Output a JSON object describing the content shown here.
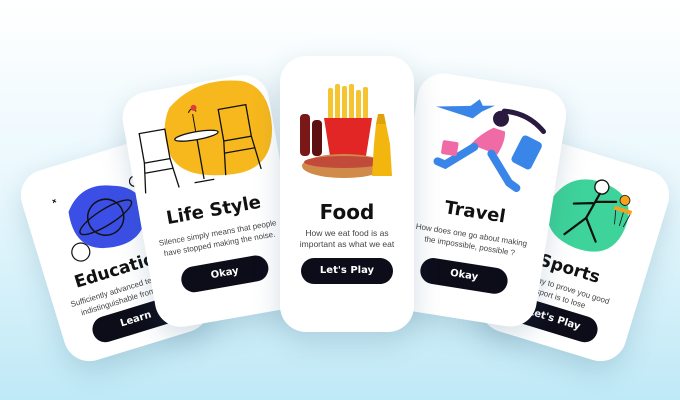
{
  "cards": [
    {
      "title": "Education",
      "text": "Sufficiently advanced technolo is indistinguishable from magic",
      "button": "Learn",
      "blob_color": "#3b4fe6"
    },
    {
      "title": "Life Style",
      "text": "Silence simply means that people have stopped making the noise.",
      "button": "Okay",
      "blob_color": "#f7b81d"
    },
    {
      "title": "Food",
      "text": "How we eat food is as important as what we eat",
      "button": "Let's Play"
    },
    {
      "title": "Travel",
      "text": "How does one go about making the impossible, possible ?",
      "button": "Okay"
    },
    {
      "title": "Sports",
      "text": "...ly way to prove you good sport is to lose",
      "button": "Let's Play",
      "blob_color": "#3ed39a"
    }
  ],
  "colors": {
    "button_bg": "#0d0d1a",
    "education_blob": "#3b4fe6",
    "lifestyle_blob": "#f7b81d",
    "sports_blob": "#3ed39a",
    "background": "#bfe9f6"
  },
  "icons": [
    "planet-illustration-icon",
    "cafe-chairs-illustration-icon",
    "fast-food-illustration-icon",
    "traveler-airplane-illustration-icon",
    "basketball-player-illustration-icon"
  ]
}
